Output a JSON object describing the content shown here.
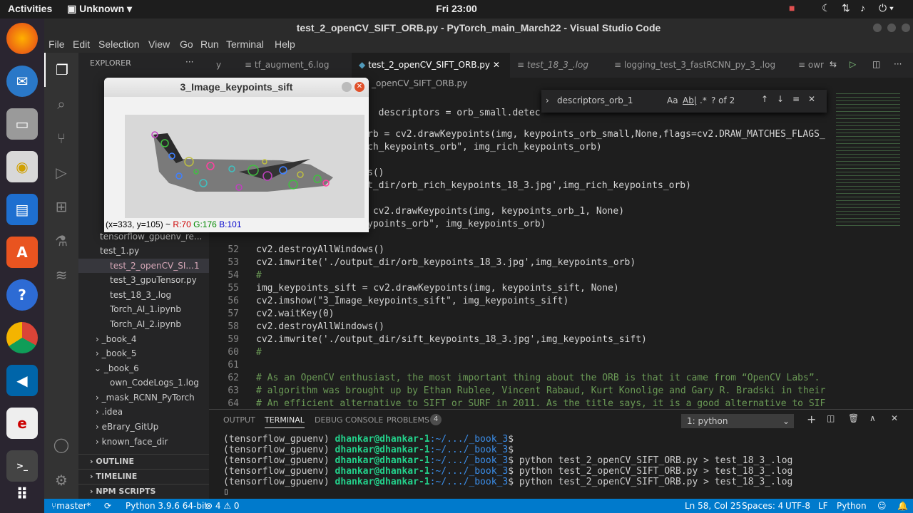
{
  "ubuntu": {
    "activities": "Activities",
    "app_menu": "Unknown",
    "clock": "Fri 23:00",
    "tray_icons": [
      "camera-icon",
      "moon-icon",
      "network-icon",
      "volume-icon",
      "power-icon"
    ]
  },
  "window": {
    "title": "test_2_openCV_SIFT_ORB.py - PyTorch_main_March22 - Visual Studio Code"
  },
  "menu": [
    "File",
    "Edit",
    "Selection",
    "View",
    "Go",
    "Run",
    "Terminal",
    "Help"
  ],
  "sidebar": {
    "header": "EXPLORER",
    "items": [
      {
        "label": "tensorflow_gpuenv_re..."
      },
      {
        "label": "test_1.py"
      },
      {
        "label": "test_2_openCV_SI...",
        "badge": "1"
      },
      {
        "label": "test_3_gpuTensor.py"
      },
      {
        "label": "test_18_3_.log"
      },
      {
        "label": "Torch_AI_1.ipynb"
      },
      {
        "label": "Torch_AI_2.ipynb"
      },
      {
        "label": "_book_4"
      },
      {
        "label": "_book_5"
      },
      {
        "label": "_book_6"
      },
      {
        "label": "own_CodeLogs_1.log"
      },
      {
        "label": "_mask_RCNN_PyTorch"
      },
      {
        "label": ".idea"
      },
      {
        "label": "eBrary_GitUp"
      },
      {
        "label": "known_face_dir"
      }
    ],
    "sections": [
      "OUTLINE",
      "TIMELINE",
      "NPM SCRIPTS"
    ]
  },
  "tabs": [
    "y",
    "tf_augment_6.log",
    "test_2_openCV_SIFT_ORB.py",
    "test_18_3_.log",
    "logging_test_3_fastRCNN_py_3_.log",
    "owr"
  ],
  "breadcrumb": "_openCV_SIFT_ORB.py",
  "find": {
    "value": "descriptors_orb_1",
    "count": "? of 2",
    "aa": "Aa",
    "ab": "Ab|",
    "regex": ".*"
  },
  "code": [
    {
      "n": "",
      "t": "  descriptors = orb_small.detec"
    },
    {
      "n": "",
      "t": "rb = cv2.drawKeypoints(img, keypoints_orb_small,None,flags=cv2.DRAW_MATCHES_FLAGS_"
    },
    {
      "n": "",
      "t": "ch_keypoints_orb\", img_rich_keypoints_orb)"
    },
    {
      "n": "",
      "t": ""
    },
    {
      "n": "",
      "t": "s()"
    },
    {
      "n": "",
      "t": "t_dir/orb_rich_keypoints_18_3.jpg',img_rich_keypoints_orb)"
    },
    {
      "n": "",
      "t": ""
    },
    {
      "n": "",
      "t": " cv2.drawKeypoints(img, keypoints_orb_1, None)"
    },
    {
      "n": "",
      "t": "ypoints_orb\", img_keypoints_orb)"
    },
    {
      "n": "",
      "t": ""
    },
    {
      "n": "52",
      "t": "cv2.destroyAllWindows()"
    },
    {
      "n": "53",
      "t": "cv2.imwrite('./output_dir/orb_keypoints_18_3.jpg',img_keypoints_orb)"
    },
    {
      "n": "54",
      "t": "#"
    },
    {
      "n": "55",
      "t": "img_keypoints_sift = cv2.drawKeypoints(img, keypoints_sift, None)"
    },
    {
      "n": "56",
      "t": "cv2.imshow(\"3_Image_keypoints_sift\", img_keypoints_sift)"
    },
    {
      "n": "57",
      "t": "cv2.waitKey(0)"
    },
    {
      "n": "58",
      "t": "cv2.destroyAllWindows()"
    },
    {
      "n": "59",
      "t": "cv2.imwrite('./output_dir/sift_keypoints_18_3.jpg',img_keypoints_sift)"
    },
    {
      "n": "60",
      "t": "#"
    },
    {
      "n": "61",
      "t": ""
    },
    {
      "n": "62",
      "t": "# As an OpenCV enthusiast, the most important thing about the ORB is that it came from “OpenCV Labs”."
    },
    {
      "n": "63",
      "t": "# algorithm was brought up by Ethan Rublee, Vincent Rabaud, Kurt Konolige and Gary R. Bradski in their"
    },
    {
      "n": "64",
      "t": "# An efficient alternative to SIFT or SURF in 2011. As the title says, it is a good alternative to SIF"
    },
    {
      "n": "65",
      "t": "# in computation cost, matching performance and mainly the patents. Yes, SIFT and SURF are patented an"
    }
  ],
  "panel": {
    "tabs": [
      "OUTPUT",
      "TERMINAL",
      "DEBUG CONSOLE",
      "PROBLEMS"
    ],
    "problems_count": "4",
    "terminal_select": "1: python",
    "lines": [
      {
        "env": "(tensorflow_gpuenv) ",
        "user": "dhankar@dhankar-1",
        "path": ":~/.../_book_3",
        "cmd": "$"
      },
      {
        "env": "(tensorflow_gpuenv) ",
        "user": "dhankar@dhankar-1",
        "path": ":~/.../_book_3",
        "cmd": "$"
      },
      {
        "env": "(tensorflow_gpuenv) ",
        "user": "dhankar@dhankar-1",
        "path": ":~/.../_book_3",
        "cmd": "$ python test_2_openCV_SIFT_ORB.py > test_18_3_.log"
      },
      {
        "env": "(tensorflow_gpuenv) ",
        "user": "dhankar@dhankar-1",
        "path": ":~/.../_book_3",
        "cmd": "$ python test_2_openCV_SIFT_ORB.py > test_18_3_.log"
      },
      {
        "env": "(tensorflow_gpuenv) ",
        "user": "dhankar@dhankar-1",
        "path": ":~/.../_book_3",
        "cmd": "$ python test_2_openCV_SIFT_ORB.py > test_18_3_.log"
      }
    ]
  },
  "status": {
    "branch": "master*",
    "python": "Python 3.9.6 64-bit",
    "problems": "⊗ 4 ⚠ 0",
    "position": "Ln 58, Col 25",
    "spaces": "Spaces: 4",
    "encoding": "UTF-8",
    "eol": "LF",
    "language": "Python"
  },
  "cv_window": {
    "title": "3_Image_keypoints_sift",
    "coords": "(x=333, y=105) ~",
    "r": "R:70",
    "g": "G:176",
    "b": "B:101"
  },
  "colors": {
    "accent": "#007acc",
    "dock": "#2a2530"
  }
}
